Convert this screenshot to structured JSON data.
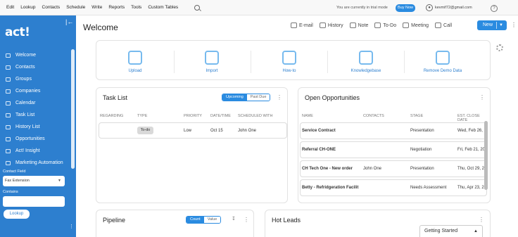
{
  "menubar": {
    "items": [
      "Edit",
      "Lookup",
      "Contacts",
      "Schedule",
      "Write",
      "Reports",
      "Tools",
      "Custom Tables"
    ],
    "trial_text": "You are currently in trial mode",
    "buy_now": "Buy Now",
    "user_email": "kevmif72@gmail.com",
    "user_icon": "user-circle-icon",
    "help_icon": "question-icon"
  },
  "sidebar": {
    "logo": "act!",
    "items": [
      {
        "label": "Welcome",
        "icon": "home-icon"
      },
      {
        "label": "Contacts",
        "icon": "contacts-icon"
      },
      {
        "label": "Groups",
        "icon": "groups-icon"
      },
      {
        "label": "Companies",
        "icon": "companies-icon"
      },
      {
        "label": "Calendar",
        "icon": "calendar-icon"
      },
      {
        "label": "Task List",
        "icon": "task-list-icon"
      },
      {
        "label": "History List",
        "icon": "history-icon"
      },
      {
        "label": "Opportunities",
        "icon": "opportunities-icon"
      },
      {
        "label": "Act! Insight",
        "icon": "insight-icon"
      },
      {
        "label": "Marketing Automation",
        "icon": "marketing-icon"
      }
    ],
    "contact_field_label": "Contact Field",
    "contact_field_value": "Fax Extension",
    "contains_label": "Contains",
    "contains_value": "",
    "lookup_button": "Lookup"
  },
  "header": {
    "title": "Welcome",
    "actions": [
      {
        "label": "E-mail",
        "icon": "email-icon"
      },
      {
        "label": "History",
        "icon": "history-icon"
      },
      {
        "label": "Note",
        "icon": "note-icon"
      },
      {
        "label": "To-Do",
        "icon": "todo-icon"
      },
      {
        "label": "Meeting",
        "icon": "meeting-icon"
      },
      {
        "label": "Call",
        "icon": "call-icon"
      }
    ],
    "new_button": "New"
  },
  "quick_links": [
    {
      "label": "Upload",
      "icon": "upload-icon"
    },
    {
      "label": "Import",
      "icon": "import-icon"
    },
    {
      "label": "How-to",
      "icon": "lightbulb-icon"
    },
    {
      "label": "Knowledgebase",
      "icon": "graduation-cap-icon"
    },
    {
      "label": "Remove Demo Data",
      "icon": "remove-data-icon"
    }
  ],
  "task_list": {
    "title": "Task List",
    "toggle": [
      "Upcoming",
      "Past Due"
    ],
    "columns": [
      "REGARDING",
      "TYPE",
      "PRIORITY",
      "DATE/TIME",
      "SCHEDULED WITH"
    ],
    "rows": [
      {
        "regarding": "",
        "type": "To-do",
        "priority": "Low",
        "date": "Oct 15",
        "with": "John One"
      }
    ]
  },
  "opportunities": {
    "title": "Open Opportunities",
    "columns": [
      "NAME",
      "CONTACTS",
      "STAGE",
      "EST. CLOSE DATE"
    ],
    "rows": [
      {
        "name": "Service Contract",
        "contact": "",
        "stage": "Presentation",
        "close": "Wed, Feb 26, 2"
      },
      {
        "name": "Referral CH-ONE",
        "contact": "",
        "stage": "Negotiation",
        "close": "Fri, Feb 21, 20"
      },
      {
        "name": "CH Tech One - New order",
        "contact": "John One",
        "stage": "Presentation",
        "close": "Thu, Oct 29, 2"
      },
      {
        "name": "Betty - Refridgeration Facilit",
        "contact": "",
        "stage": "Needs Assessment",
        "close": "Thu, Apr 23, 2"
      }
    ]
  },
  "pipeline": {
    "title": "Pipeline",
    "toggle": [
      "Count",
      "Value"
    ]
  },
  "hot_leads": {
    "title": "Hot Leads"
  },
  "getting_started": "Getting Started"
}
